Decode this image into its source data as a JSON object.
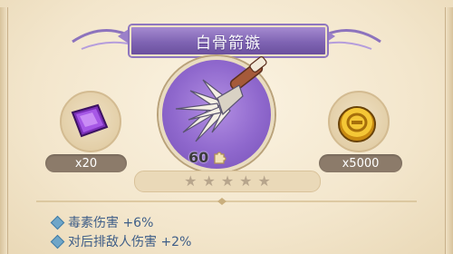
{
  "item": {
    "name": "白骨箭镞",
    "fragment_count": "60"
  },
  "materials": {
    "left": {
      "icon": "purple-gem-icon",
      "count": "x20"
    },
    "right": {
      "icon": "gold-coin-icon",
      "count": "x5000"
    }
  },
  "stars": {
    "filled": 0,
    "total": 5
  },
  "stats": [
    {
      "text": "毒素伤害 +6%"
    },
    {
      "text": "对后排敌人伤害 +2%"
    }
  ],
  "colors": {
    "title_plate": "#7f64b3",
    "disc": "#8f68cd",
    "stat_text": "#3f5e88",
    "badge": "#8c7b6a"
  }
}
